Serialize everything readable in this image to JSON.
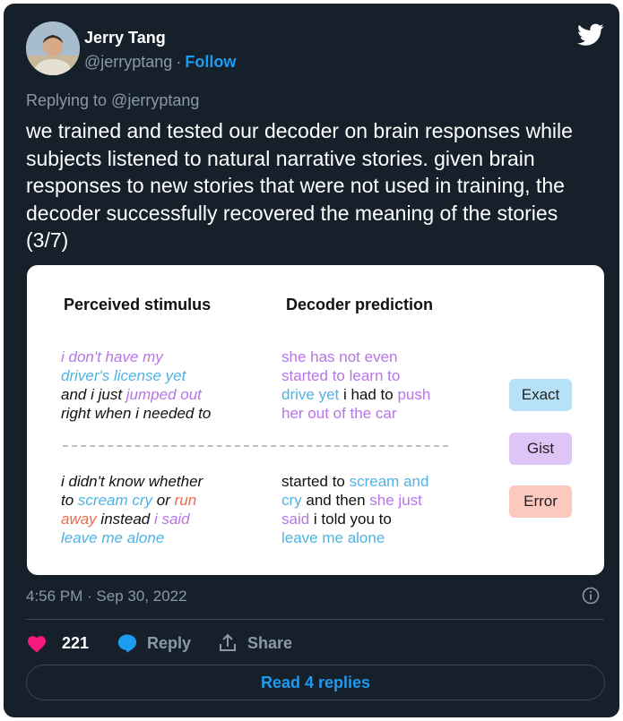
{
  "author": {
    "name": "Jerry Tang",
    "handle": "@jerryptang",
    "separator": "·",
    "follow_label": "Follow"
  },
  "replying_to": "Replying to @jerryptang",
  "tweet_text": "we trained and tested our decoder on brain responses while subjects listened to natural narrative stories. given brain responses to new stories that were not used in training, the decoder successfully recovered the meaning of the stories (3/7)",
  "figure": {
    "col1_header": "Perceived stimulus",
    "col2_header": "Decoder prediction",
    "example1": {
      "stimulus": [
        [
          {
            "t": "i don't have my",
            "c": "purple",
            "i": true
          }
        ],
        [
          {
            "t": "driver's license yet",
            "c": "blue",
            "i": true
          }
        ],
        [
          {
            "t": "and i just ",
            "c": "black",
            "i": true
          },
          {
            "t": "jumped out",
            "c": "purple",
            "i": true
          }
        ],
        [
          {
            "t": "right when i needed to",
            "c": "black",
            "i": true
          }
        ]
      ],
      "prediction": [
        [
          {
            "t": "she has not even",
            "c": "purple",
            "i": false
          }
        ],
        [
          {
            "t": "started to learn to",
            "c": "purple",
            "i": false
          }
        ],
        [
          {
            "t": "drive yet",
            "c": "blue",
            "i": false
          },
          {
            "t": " i had to ",
            "c": "black",
            "i": false
          },
          {
            "t": "push",
            "c": "purple",
            "i": false
          }
        ],
        [
          {
            "t": "her out of the car",
            "c": "purple",
            "i": false
          }
        ]
      ]
    },
    "example2": {
      "stimulus": [
        [
          {
            "t": "i didn't know whether",
            "c": "black",
            "i": true
          }
        ],
        [
          {
            "t": "to ",
            "c": "black",
            "i": true
          },
          {
            "t": "scream cry",
            "c": "blue",
            "i": true
          },
          {
            "t": " or ",
            "c": "black",
            "i": true
          },
          {
            "t": "run",
            "c": "red",
            "i": true
          }
        ],
        [
          {
            "t": "away",
            "c": "red",
            "i": true
          },
          {
            "t": " instead ",
            "c": "black",
            "i": true
          },
          {
            "t": "i said",
            "c": "purple",
            "i": true
          }
        ],
        [
          {
            "t": "leave me alone",
            "c": "blue",
            "i": true
          }
        ]
      ],
      "prediction": [
        [
          {
            "t": "started to ",
            "c": "black",
            "i": false
          },
          {
            "t": "scream and",
            "c": "blue",
            "i": false
          }
        ],
        [
          {
            "t": "cry",
            "c": "blue",
            "i": false
          },
          {
            "t": " and then ",
            "c": "black",
            "i": false
          },
          {
            "t": "she just",
            "c": "purple",
            "i": false
          }
        ],
        [
          {
            "t": "said",
            "c": "purple",
            "i": false
          },
          {
            "t": " i told you to",
            "c": "black",
            "i": false
          }
        ],
        [
          {
            "t": "leave me alone",
            "c": "blue",
            "i": false
          }
        ]
      ]
    },
    "legend": [
      {
        "label": "Exact",
        "color": "#b7e1f7"
      },
      {
        "label": "Gist",
        "color": "#dfc4f7"
      },
      {
        "label": "Error",
        "color": "#fcc9be"
      }
    ]
  },
  "timestamp": "4:56 PM · Sep 30, 2022",
  "actions": {
    "likes": "221",
    "reply_label": "Reply",
    "share_label": "Share"
  },
  "read_replies_label": "Read 4 replies",
  "colors": {
    "background": "#15202b",
    "accent": "#1d9bf0",
    "like": "#f91880",
    "muted": "#8b98a5"
  }
}
